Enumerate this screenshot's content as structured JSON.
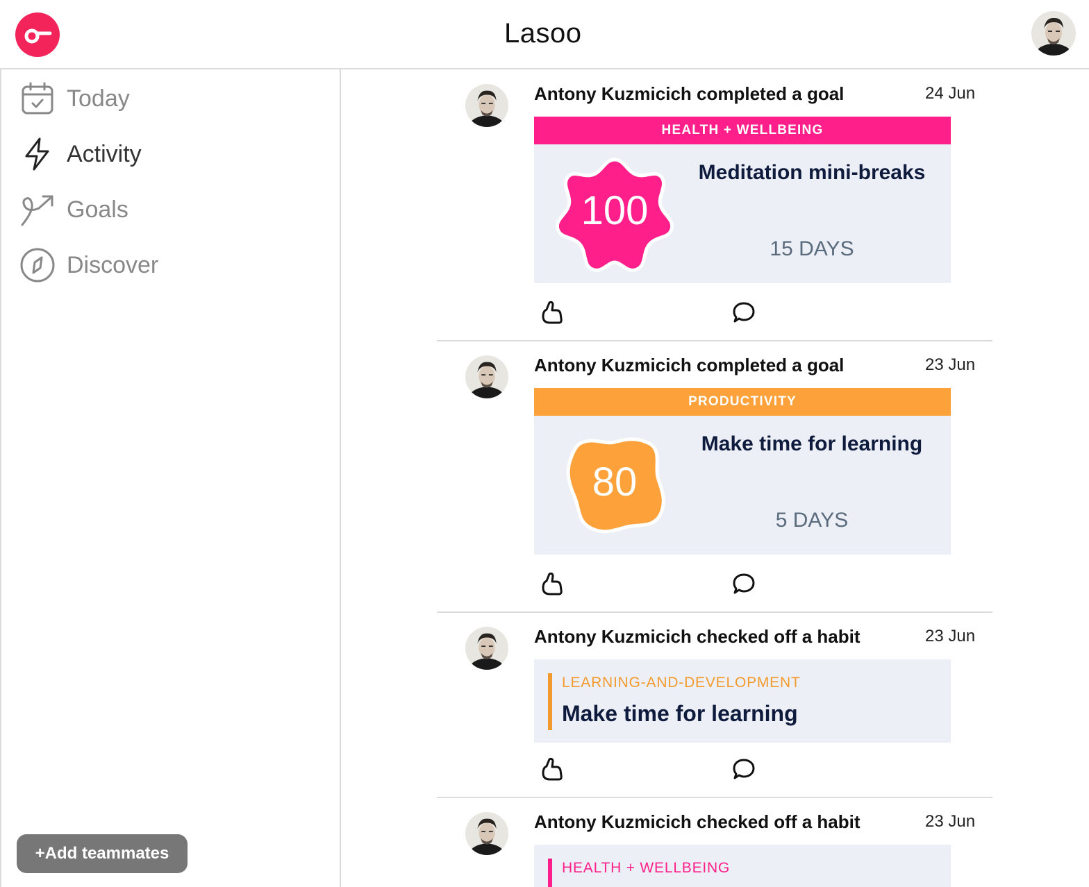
{
  "header": {
    "brand": "Lasoo"
  },
  "sidebar": {
    "items": [
      {
        "label": "Today",
        "icon": "calendar-check-icon"
      },
      {
        "label": "Activity",
        "icon": "lightning-icon"
      },
      {
        "label": "Goals",
        "icon": "goal-arrow-icon"
      },
      {
        "label": "Discover",
        "icon": "compass-icon"
      }
    ],
    "add_button": "+Add teammates"
  },
  "colors": {
    "brand": "#f2245a",
    "health": "#ff1f8a",
    "productivity": "#fda13a",
    "learning": "#f39a2e"
  },
  "feed": {
    "posts": [
      {
        "title": "Antony Kuzmicich completed a goal",
        "date": "24 Jun",
        "category": "HEALTH + WELLBEING",
        "badge": "100",
        "goal": "Meditation mini-breaks",
        "days": "15 DAYS"
      },
      {
        "title": "Antony Kuzmicich completed a goal",
        "date": "23 Jun",
        "category": "PRODUCTIVITY",
        "badge": "80",
        "goal": "Make time for learning",
        "days": "5 DAYS"
      },
      {
        "title": "Antony Kuzmicich checked off a habit",
        "date": "23 Jun",
        "category": "LEARNING-AND-DEVELOPMENT",
        "habit": "Make time for learning"
      },
      {
        "title": "Antony Kuzmicich checked off a habit",
        "date": "23 Jun",
        "category": "HEALTH + WELLBEING"
      }
    ]
  }
}
